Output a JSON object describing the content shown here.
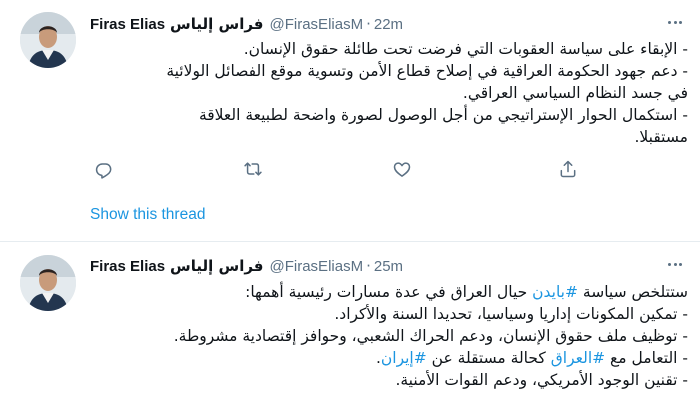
{
  "tweets": [
    {
      "author_name": "Firas Elias",
      "author_name_ar": "فراس إلياس",
      "handle": "@FirasEliasM",
      "separator": "·",
      "time": "22m",
      "lines": [
        "- الإبقاء على سياسة العقوبات التي فرضت تحت طائلة حقوق الإنسان.",
        "- دعم جهود الحكومة العراقية في إصلاح قطاع الأمن وتسوية موقع الفصائل الولائية",
        "في جسد النظام السياسي العراقي.",
        "- استكمال الحوار الإستراتيجي من أجل الوصول لصورة واضحة لطبيعة العلاقة",
        "مستقبلا."
      ],
      "show_thread": "Show this thread"
    },
    {
      "author_name": "Firas Elias",
      "author_name_ar": "فراس إلياس",
      "handle": "@FirasEliasM",
      "separator": "·",
      "time": "25m",
      "line1_prefix": "ستتلخص سياسة ",
      "line1_hashtag": "#بايدن",
      "line1_suffix": " حيال العراق في عدة مسارات رئيسية أهمها:",
      "line2": "- تمكين المكونات إداريا وسياسيا، تحديدا السنة والأكراد.",
      "line3": "- توظيف ملف حقوق الإنسان، ودعم الحراك الشعبي، وحوافز إقتصادية مشروطة.",
      "line4_prefix": "- التعامل مع ",
      "line4_hashtag1": "#العراق",
      "line4_mid": " كحالة مستقلة عن ",
      "line4_hashtag2": "#إيران",
      "line4_suffix": ".",
      "line5": "- تقنين الوجود الأمريكي، ودعم القوات الأمنية."
    }
  ],
  "icons": {
    "reply": "reply-icon",
    "retweet": "retweet-icon",
    "like": "like-icon",
    "share": "share-icon",
    "more": "more-icon"
  },
  "colors": {
    "link": "#1b95e0",
    "secondary": "#5b7083",
    "divider": "#e6ecf0"
  }
}
